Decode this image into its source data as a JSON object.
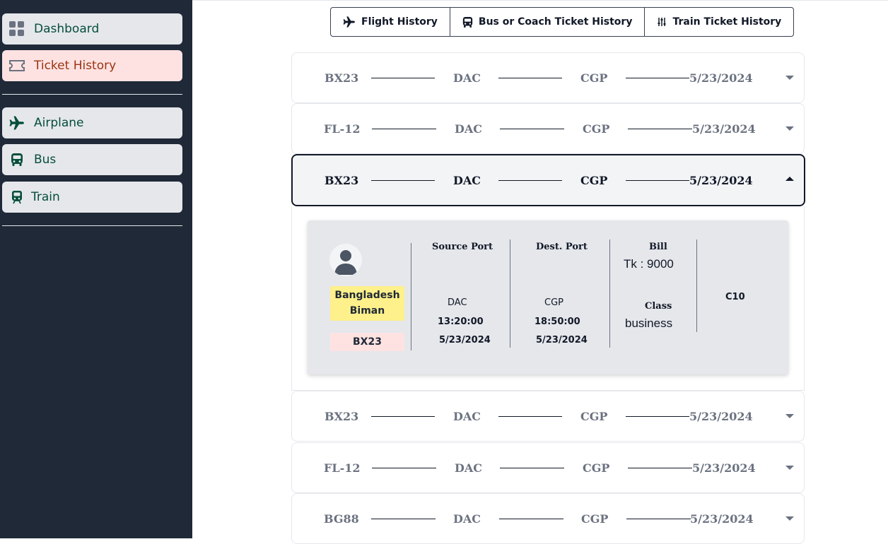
{
  "sidebar": {
    "items": [
      {
        "label": "Dashboard",
        "icon": "grid-icon"
      },
      {
        "label": "Ticket History",
        "icon": "ticket-icon"
      },
      {
        "label": "Airplane",
        "icon": "airplane-icon"
      },
      {
        "label": "Bus",
        "icon": "bus-icon"
      },
      {
        "label": "Train",
        "icon": "train-icon"
      }
    ]
  },
  "tabs": [
    {
      "label": "Flight History",
      "icon": "airplane-icon"
    },
    {
      "label": "Bus or Coach Ticket History",
      "icon": "bus-icon"
    },
    {
      "label": "Train Ticket History",
      "icon": "sliders-icon"
    }
  ],
  "tickets": [
    {
      "code": "BX23",
      "from": "DAC",
      "to": "CGP",
      "date": "5/23/2024"
    },
    {
      "code": "FL-12",
      "from": "DAC",
      "to": "CGP",
      "date": "5/23/2024"
    },
    {
      "code": "BX23",
      "from": "DAC",
      "to": "CGP",
      "date": "5/23/2024"
    },
    {
      "code": "BX23",
      "from": "DAC",
      "to": "CGP",
      "date": "5/23/2024"
    },
    {
      "code": "FL-12",
      "from": "DAC",
      "to": "CGP",
      "date": "5/23/2024"
    },
    {
      "code": "BG88",
      "from": "DAC",
      "to": "CGP",
      "date": "5/23/2024"
    }
  ],
  "detail": {
    "airline": "Bangladesh Biman",
    "code": "BX23",
    "source_label": "Source Port",
    "source_port": "DAC",
    "source_time": "13:20:00",
    "source_date": "5/23/2024",
    "dest_label": "Dest. Port",
    "dest_port": "CGP",
    "dest_time": "18:50:00",
    "dest_date": "5/23/2024",
    "bill_label": "Bill",
    "bill": "Tk : 9000",
    "class_label": "Class",
    "class": "business",
    "seat": "C10"
  },
  "colors": {
    "sidebar_bg": "#1f2937",
    "active_bg": "#fee2e2",
    "active_text": "#9a3412",
    "nav_text": "#064e3b",
    "airline_badge": "#fef08a"
  }
}
